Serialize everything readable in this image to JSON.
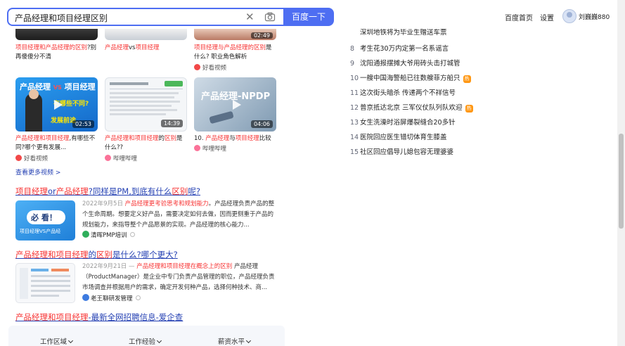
{
  "search": {
    "query": "产品经理和项目经理区别",
    "button_label": "百度一下"
  },
  "header": {
    "home_link": "百度首页",
    "settings_link": "设置",
    "username": "刘巍巍880"
  },
  "videos_top": [
    {
      "title_red": "项目经理和产品经理的区别",
      "title_rest": "?别再傻傻分不清",
      "duration": ""
    },
    {
      "title_red": "产品经理",
      "title_mid": "vs",
      "title_red2": "项目经理",
      "duration": ""
    },
    {
      "title_red": "项目经理与产品经理的区别",
      "title_rest": "是什么? 职业角色解析",
      "duration": "02:49",
      "source": "好看视频"
    }
  ],
  "videos": [
    {
      "title_red": "产品经理和项目经理",
      "title_rest": ",有哪些不同?哪个更有发展...",
      "duration": "02:53",
      "source": "好看视频",
      "thumb_text1": "产品经理",
      "thumb_text2": "项目经理",
      "thumb_text3": "发展前途"
    },
    {
      "title_red": "产品经理和项目经理",
      "title_mid": "的",
      "title_red2": "区别",
      "title_rest": "是什么??",
      "duration": "14:39",
      "source": "哔哩哔哩"
    },
    {
      "title_pre": "10. ",
      "title_red": "产品经理",
      "title_mid": "与",
      "title_red2": "项目经理",
      "title_rest": "比较",
      "duration": "04:06",
      "source": "哔哩哔哩",
      "thumb_text1": "产品经理-NPDP"
    }
  ],
  "more_videos": "查看更多视频 >",
  "results": [
    {
      "title_parts": [
        "项目经理",
        "or",
        "产品经理",
        "?同样是PM,到底有什么",
        "区别",
        "呢?"
      ],
      "date": "2022年9月5日",
      "snippet_red": "产品经理更考验思考和规划能力",
      "snippet": "。产品经理负责产品的整个生命周期。想要定义好产品，需要决定如何去做，因而更侧重于产品的规划能力，来指导整个产品愿景的实现。产品经理的核心能力...",
      "source": "清晖PMP培训",
      "thumb_text1": "必 看！",
      "thumb_text2": "项目经理VS产品经"
    },
    {
      "title_parts": [
        "产品经理和项目经理",
        "的",
        "区别",
        "是什么?哪个更大?"
      ],
      "date": "2022年9月21日 —",
      "snippet_red": "产品经理和项目经理在概念上的区别",
      "snippet": " 产品经理（ProductManager）是企业中专门负责产品管理的职位，产品经理负责市场调查并根据用户的需求，确定开发何种产品，选择何种技术、商...",
      "source": "老王聊研发管理"
    },
    {
      "title_parts": [
        "产品经理和项目经理",
        "-最新全网招聘信息-爱企查"
      ]
    }
  ],
  "filters": [
    "工作区域",
    "工作经验",
    "薪资水平"
  ],
  "hot_list": [
    {
      "num": "",
      "text": "深圳地铁将为毕业生赠送车票",
      "tag": ""
    },
    {
      "num": "8",
      "text": "考生花30万内定第一名系谣言",
      "tag": ""
    },
    {
      "num": "9",
      "text": "沈阳通报摆摊大爷用砖头击打城管",
      "tag": ""
    },
    {
      "num": "10",
      "text": "一艘中国海警船已往数艘菲方船只",
      "tag": "热"
    },
    {
      "num": "11",
      "text": "这次街头暗杀 传递两个不祥信号",
      "tag": ""
    },
    {
      "num": "12",
      "text": "普京抵达北京 三军仪仗队列队欢迎",
      "tag": "热"
    },
    {
      "num": "13",
      "text": "女生洗澡时浴屏爆裂缝合20多针",
      "tag": ""
    },
    {
      "num": "14",
      "text": "医院回应医生错切体育生膝盖",
      "tag": ""
    },
    {
      "num": "15",
      "text": "社区回应倡导儿媳包容无理婆婆",
      "tag": ""
    }
  ],
  "colors": {
    "brand_blue": "#4e6ef2",
    "link_blue": "#2440b3",
    "highlight_red": "#f73131",
    "hot_orange": "#ff9712"
  }
}
